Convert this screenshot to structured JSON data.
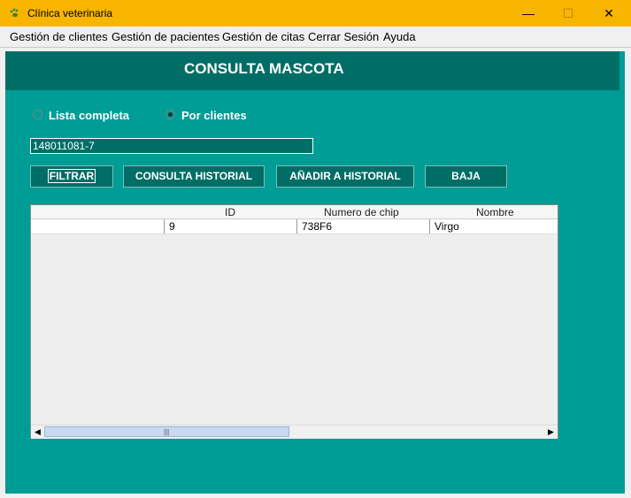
{
  "window": {
    "title": "Clínica veterinaria",
    "app_icon": "paw-icon",
    "controls": {
      "minimize": "—",
      "maximize": "☐",
      "close": "✕"
    }
  },
  "menu": {
    "items": [
      "Gestión de clientes",
      "Gestión de pacientes",
      "Gestión de citas",
      "Cerrar Sesión",
      "Ayuda"
    ]
  },
  "page": {
    "title": "CONSULTA MASCOTA",
    "radio_options": [
      {
        "label": "Lista completa",
        "selected": false
      },
      {
        "label": "Por clientes",
        "selected": true
      }
    ],
    "client_id": {
      "value": "148011081-7"
    },
    "buttons": {
      "filter": "FILTRAR",
      "history": "CONSULTA HISTORIAL",
      "add_history": "AÑADIR A HISTORIAL",
      "remove": "BAJA"
    }
  },
  "table": {
    "columns": [
      "",
      "ID",
      "Numero de chip",
      "Nombre"
    ],
    "rows": [
      {
        "blank": "",
        "id": "9",
        "chip": "738F6",
        "name": "Virgo"
      }
    ],
    "scroll": {
      "left_arrow": "◀",
      "right_arrow": "▶",
      "grip": "|||"
    }
  },
  "colors": {
    "title_bar": "#f8b500",
    "panel": "#009c96",
    "header_band": "#006e66",
    "button": "#006e66"
  }
}
